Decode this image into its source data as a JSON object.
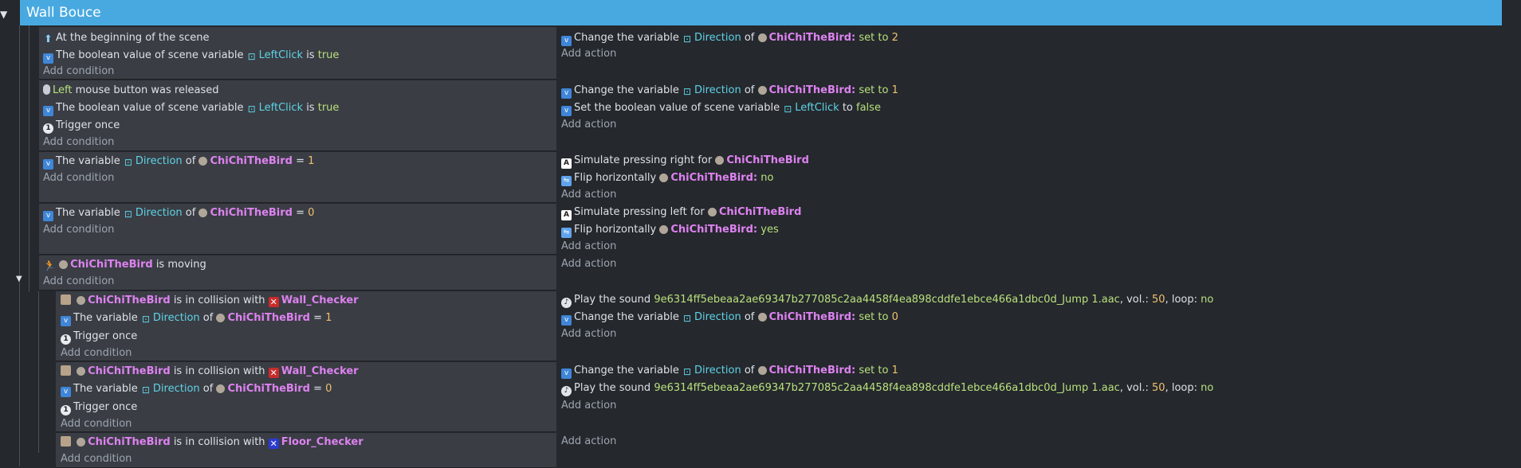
{
  "group": {
    "title": "Wall Bouce"
  },
  "common": {
    "add_condition": "Add condition",
    "add_action": "Add action",
    "change_var": "Change the variable",
    "of": "of",
    "set_to": "set to",
    "the_variable": "The variable",
    "bool_scene": "The boolean value of scene variable",
    "is": "is",
    "true": "true",
    "trigger_once": "Trigger once",
    "eq": "=",
    "flip_h": "Flip horizontally",
    "sim_right": "Simulate pressing right for",
    "sim_left": "Simulate pressing left for",
    "is_in_collision": "is in collision with",
    "play_sound": "Play the sound",
    "vol": ", vol.:",
    "loop": ", loop:",
    "no": "no",
    "yes": "yes",
    "colon": ":"
  },
  "names": {
    "direction": "Direction",
    "leftclick": "LeftClick",
    "bird": "ChiChiTheBird",
    "wall": "Wall_Checker",
    "floor": "Floor_Checker",
    "sound_file": "9e6314ff5ebeaa2ae69347b277085c2aa4458f4ea898cddfe1ebce466a1dbc0d_Jump 1.aac",
    "vol_value": "50"
  },
  "events": [
    {
      "conditions": [
        "At the beginning of the scene"
      ],
      "action_values": [
        "2"
      ]
    },
    {
      "mouse_left": "Left",
      "mouse_rest": "mouse button was released",
      "action_values": [
        "1"
      ],
      "set_bool_text": "Set the boolean value of scene variable",
      "to": "to",
      "false": "false"
    },
    {
      "compare_value": "1"
    },
    {
      "compare_value": "0"
    },
    {
      "is_moving": "is moving"
    },
    {
      "compare_value": "1",
      "action_value": "0"
    },
    {
      "compare_value": "0",
      "action_value": "1"
    }
  ],
  "colors": {
    "header": "#48a9e0",
    "condition_bg": "#3a3d44",
    "action_bg": "#25282d",
    "variable_name": "#5ed3e6",
    "object_name": "#dd82f0",
    "number": "#f0c06e",
    "literal": "#b8e07c"
  },
  "icons": [
    "start-scene-icon",
    "scene-variable-icon",
    "mouse-icon",
    "trigger-once-icon",
    "object-icon",
    "keyboard-icon",
    "flip-icon",
    "sound-icon",
    "movement-icon",
    "collision-icon",
    "wall-checker-icon",
    "floor-checker-icon"
  ]
}
